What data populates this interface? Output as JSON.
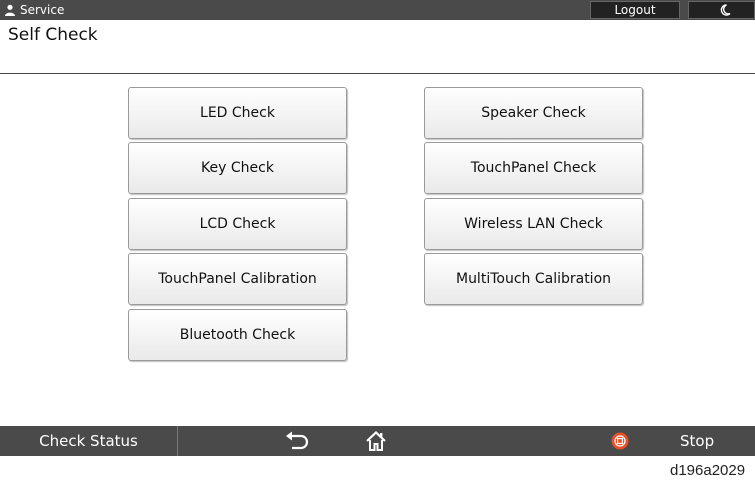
{
  "header": {
    "user_label": "Service",
    "logout_label": "Logout"
  },
  "page": {
    "title": "Self Check"
  },
  "buttons": {
    "left": [
      "LED Check",
      "Key Check",
      "LCD Check",
      "TouchPanel Calibration",
      "Bluetooth Check"
    ],
    "right": [
      "Speaker Check",
      "TouchPanel Check",
      "Wireless LAN Check",
      "MultiTouch Calibration"
    ]
  },
  "footer": {
    "check_status_label": "Check Status",
    "stop_label": "Stop"
  },
  "figure_id": "d196a2029",
  "colors": {
    "bar_background": "#4a4a4a",
    "stop_icon": "#e8502a"
  },
  "icons": [
    "user-icon",
    "moon-icon",
    "back-arrow-icon",
    "home-icon",
    "stop-icon"
  ]
}
